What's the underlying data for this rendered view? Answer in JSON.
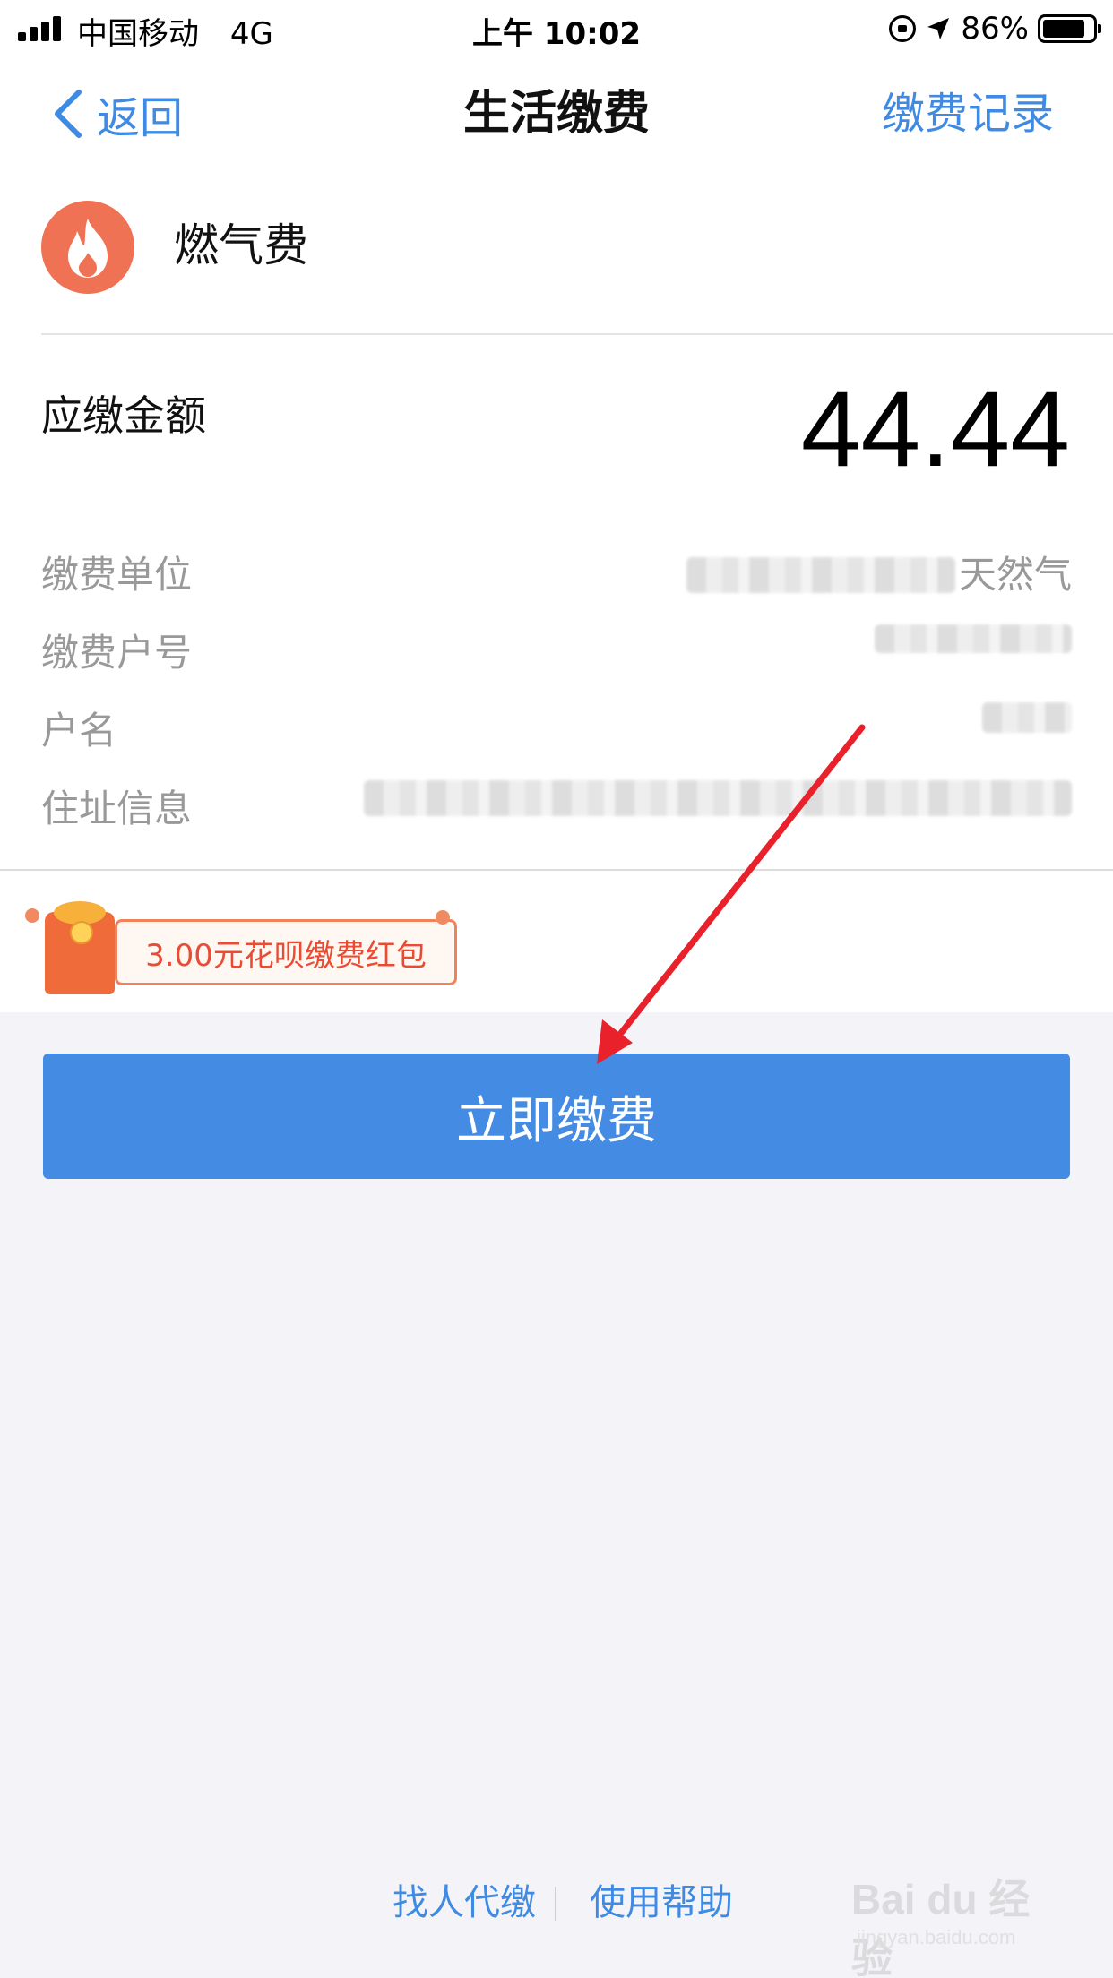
{
  "status_bar": {
    "carrier": "中国移动",
    "network": "4G",
    "time": "上午 10:02",
    "battery": "86%",
    "battery_level": 0.86
  },
  "nav": {
    "back_label": "返回",
    "title": "生活缴费",
    "right_label": "缴费记录"
  },
  "service": {
    "name": "燃气费",
    "icon": "flame-icon",
    "icon_color": "#ef7254"
  },
  "amount": {
    "label": "应缴金额",
    "value": "44.44"
  },
  "details": [
    {
      "label": "缴费单位",
      "value": "天然气"
    },
    {
      "label": "缴费户号",
      "value": ""
    },
    {
      "label": "户名",
      "value": ""
    },
    {
      "label": "住址信息",
      "value": ""
    }
  ],
  "promo": {
    "label": "3.00元花呗缴费红包"
  },
  "pay_button": {
    "label": "立即缴费",
    "color": "#438be3"
  },
  "footer": {
    "left_link": "找人代缴",
    "right_link": "使用帮助"
  },
  "watermark": {
    "text": "Bai du 经验",
    "sub": "jingyan.baidu.com"
  },
  "colors": {
    "accent": "#3f8ae2",
    "annotation_arrow": "#e8212b",
    "promo_text": "#e94c33"
  }
}
